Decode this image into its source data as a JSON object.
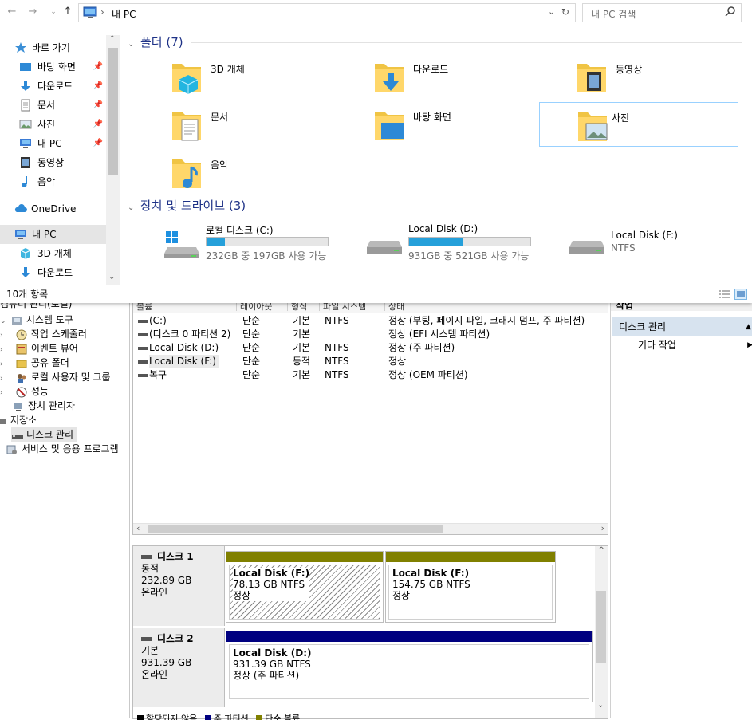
{
  "explorer": {
    "breadcrumb": "내 PC",
    "search_placeholder": "내 PC 검색",
    "status_text": "10개 항목",
    "nav": {
      "quick_access": "바로 가기",
      "quick_items": [
        "바탕 화면",
        "다운로드",
        "문서",
        "사진",
        "내 PC",
        "동영상",
        "음악"
      ],
      "onedrive": "OneDrive",
      "this_pc": "내 PC",
      "pc_children": [
        "3D 개체",
        "다운로드"
      ]
    },
    "folders_header": "폴더 (7)",
    "folders": [
      {
        "name": "3D 개체",
        "icon": "3d-objects-icon"
      },
      {
        "name": "다운로드",
        "icon": "downloads-icon"
      },
      {
        "name": "동영상",
        "icon": "videos-icon"
      },
      {
        "name": "문서",
        "icon": "documents-icon"
      },
      {
        "name": "바탕 화면",
        "icon": "desktop-icon"
      },
      {
        "name": "사진",
        "icon": "pictures-icon"
      },
      {
        "name": "음악",
        "icon": "music-icon"
      }
    ],
    "drives_header": "장치 및 드라이브 (3)",
    "drives": [
      {
        "name": "로컬 디스크 (C:)",
        "free": "232GB 중 197GB 사용 가능",
        "used_fraction": 0.15
      },
      {
        "name": "Local Disk (D:)",
        "free": "931GB 중 521GB 사용 가능",
        "used_fraction": 0.44
      },
      {
        "name": "Local Disk (F:)",
        "fs": "NTFS"
      }
    ]
  },
  "mgmt": {
    "tree_top": "컴퓨터 관리(로컬)",
    "tree": [
      "시스템 도구",
      "작업 스케줄러",
      "이벤트 뷰어",
      "공유 폴더",
      "로컬 사용자 및 그룹",
      "성능",
      "장치 관리자",
      "저장소",
      "디스크 관리",
      "서비스 및 응용 프로그램"
    ],
    "columns": [
      "볼륨",
      "레이아웃",
      "형식",
      "파일 시스템",
      "상태"
    ],
    "volumes": [
      {
        "name": "(C:)",
        "layout": "단순",
        "type": "기본",
        "fs": "NTFS",
        "status": "정상 (부팅, 페이지 파일, 크래시 덤프, 주 파티션)"
      },
      {
        "name": "(디스크 0 파티션 2)",
        "layout": "단순",
        "type": "기본",
        "fs": "",
        "status": "정상 (EFI 시스템 파티션)"
      },
      {
        "name": "Local Disk (D:)",
        "layout": "단순",
        "type": "기본",
        "fs": "NTFS",
        "status": "정상 (주 파티션)"
      },
      {
        "name": "Local Disk (F:)",
        "layout": "단순",
        "type": "동적",
        "fs": "NTFS",
        "status": "정상"
      },
      {
        "name": "복구",
        "layout": "단순",
        "type": "기본",
        "fs": "NTFS",
        "status": "정상 (OEM 파티션)"
      }
    ],
    "disks": [
      {
        "title": "디스크 1",
        "kind": "동적",
        "size": "232.89 GB",
        "state": "온라인",
        "parts": [
          {
            "name": "Local Disk  (F:)",
            "size": "78.13 GB NTFS",
            "status": "정상"
          },
          {
            "name": "Local Disk  (F:)",
            "size": "154.75 GB NTFS",
            "status": "정상"
          }
        ]
      },
      {
        "title": "디스크 2",
        "kind": "기본",
        "size": "931.39 GB",
        "state": "온라인",
        "parts": [
          {
            "name": "Local Disk  (D:)",
            "size": "931.39 GB NTFS",
            "status": "정상 (주 파티션)"
          }
        ]
      }
    ],
    "legend": [
      "할당되지 않음",
      "주 파티션",
      "단순 볼륨"
    ],
    "actions_title": "작업",
    "actions_selected": "디스크 관리",
    "actions_more": "기타 작업"
  },
  "colors": {
    "accent": "#26a0da",
    "dynamic_bar": "#808000",
    "primary_bar": "#000080",
    "nav_selected": "#cce8ff"
  }
}
